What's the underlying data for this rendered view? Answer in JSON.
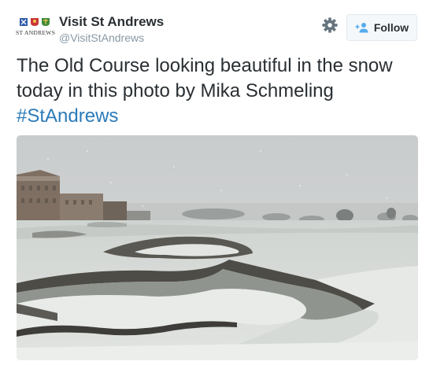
{
  "account": {
    "display_name": "Visit St Andrews",
    "handle": "@VisitStAndrews",
    "avatar_wordmark": "ST ANDREWS"
  },
  "actions": {
    "follow_label": "Follow",
    "settings_icon": "gear-icon",
    "follow_icon": "add-user-icon"
  },
  "tweet": {
    "text": "The Old Course looking beautiful in the snow today in this photo by Mika Schmeling",
    "hashtag": "#StAndrews"
  },
  "photo": {
    "subject": "snow-covered Old Course with bunker"
  },
  "colors": {
    "link": "#2b7bb9",
    "text": "#292f33",
    "muted": "#8899a6",
    "button_bg": "#f5f8fa",
    "button_border": "#e1e8ed"
  }
}
